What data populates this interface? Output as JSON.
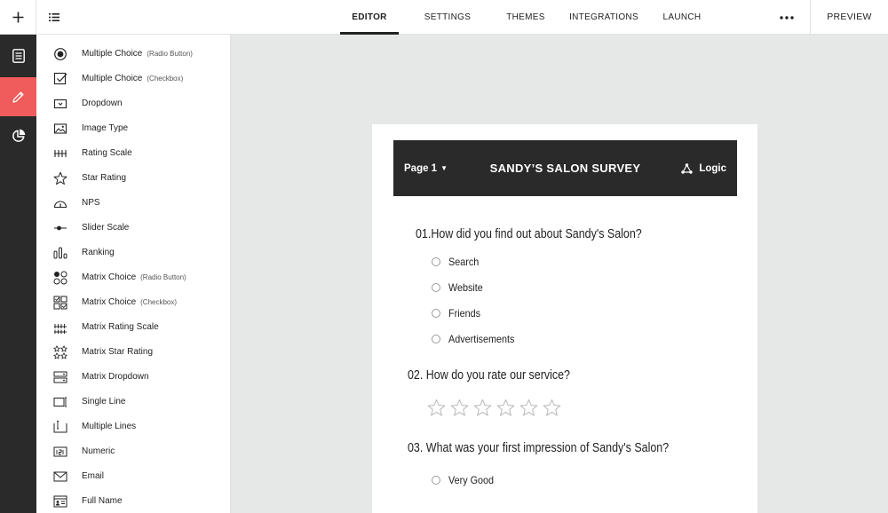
{
  "topbar": {
    "tabs": [
      {
        "label": "EDITOR",
        "active": true
      },
      {
        "label": "SETTINGS",
        "active": false
      },
      {
        "label": "THEMES",
        "active": false
      },
      {
        "label": "INTEGRATIONS",
        "active": false
      },
      {
        "label": "LAUNCH",
        "active": false
      }
    ],
    "preview_label": "PREVIEW"
  },
  "rail": {
    "items": [
      {
        "icon": "document-icon",
        "active": false
      },
      {
        "icon": "pencil-icon",
        "active": true
      },
      {
        "icon": "pie-chart-icon",
        "active": false
      }
    ],
    "accent_color": "#f05b5b"
  },
  "palette": {
    "items": [
      {
        "label": "Multiple Choice",
        "sub": "(Radio Button)",
        "icon": "radio-button-icon"
      },
      {
        "label": "Multiple Choice",
        "sub": "(Checkbox)",
        "icon": "checkbox-icon"
      },
      {
        "label": "Dropdown",
        "sub": "",
        "icon": "dropdown-icon"
      },
      {
        "label": "Image Type",
        "sub": "",
        "icon": "image-icon"
      },
      {
        "label": "Rating Scale",
        "sub": "",
        "icon": "rating-scale-icon"
      },
      {
        "label": "Star Rating",
        "sub": "",
        "icon": "star-icon"
      },
      {
        "label": "NPS",
        "sub": "",
        "icon": "gauge-icon"
      },
      {
        "label": "Slider Scale",
        "sub": "",
        "icon": "slider-icon"
      },
      {
        "label": "Ranking",
        "sub": "",
        "icon": "ranking-icon"
      },
      {
        "label": "Matrix Choice",
        "sub": "(Radio Button)",
        "icon": "matrix-radio-icon"
      },
      {
        "label": "Matrix Choice",
        "sub": "(Checkbox)",
        "icon": "matrix-checkbox-icon"
      },
      {
        "label": "Matrix Rating Scale",
        "sub": "",
        "icon": "matrix-rating-icon"
      },
      {
        "label": "Matrix Star Rating",
        "sub": "",
        "icon": "matrix-star-icon"
      },
      {
        "label": "Matrix Dropdown",
        "sub": "",
        "icon": "matrix-dropdown-icon"
      },
      {
        "label": "Single Line",
        "sub": "",
        "icon": "single-line-icon"
      },
      {
        "label": "Multiple Lines",
        "sub": "",
        "icon": "multiple-lines-icon"
      },
      {
        "label": "Numeric",
        "sub": "",
        "icon": "numeric-icon"
      },
      {
        "label": "Email",
        "sub": "",
        "icon": "email-icon"
      },
      {
        "label": "Full Name",
        "sub": "",
        "icon": "full-name-icon"
      }
    ]
  },
  "survey": {
    "page_label": "Page 1",
    "title": "SANDY’S SALON SURVEY",
    "logic_label": "Logic",
    "questions": [
      {
        "title": "01.How did you find out about Sandy's Salon?",
        "options": [
          "Search",
          "Website",
          "Friends",
          "Advertisements"
        ]
      },
      {
        "title": "02. How do you rate our service?",
        "stars": 6
      },
      {
        "title": "03. What was your first impression of Sandy's Salon?",
        "options": [
          "Very Good"
        ]
      }
    ]
  }
}
